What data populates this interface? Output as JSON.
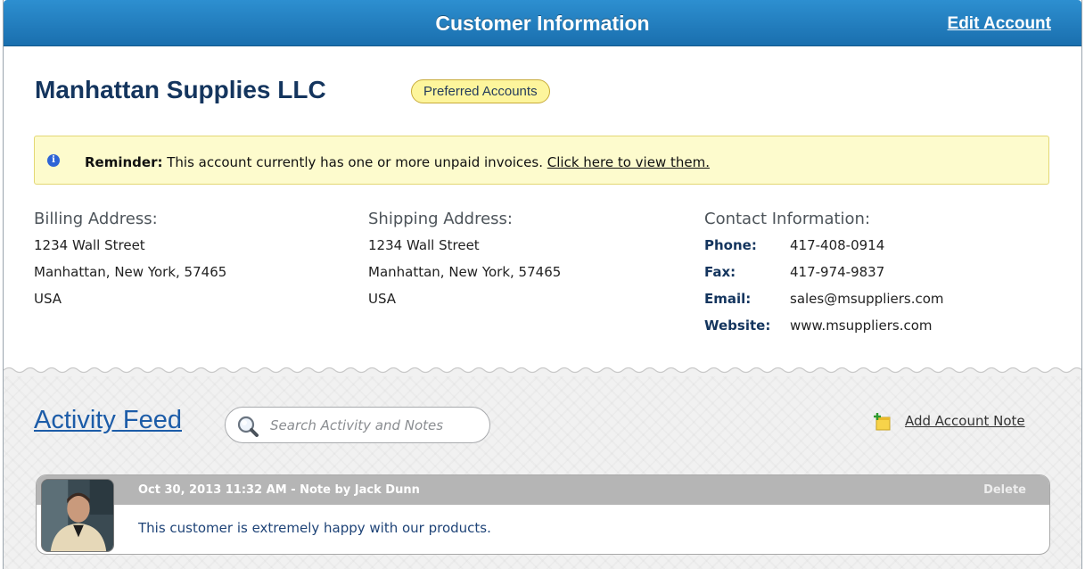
{
  "header": {
    "title": "Customer Information",
    "edit_label": "Edit Account"
  },
  "company": {
    "name": "Manhattan Supplies LLC",
    "badge": "Preferred Accounts"
  },
  "reminder": {
    "label": "Reminder:",
    "text": "This account currently has one or more unpaid invoices.",
    "link": "Click here to view them."
  },
  "billing": {
    "heading": "Billing Address:",
    "street": "1234 Wall Street",
    "city": "Manhattan, New York, 57465",
    "country": "USA"
  },
  "shipping": {
    "heading": "Shipping Address:",
    "street": "1234 Wall Street",
    "city": "Manhattan, New York, 57465",
    "country": "USA"
  },
  "contact": {
    "heading": "Contact Information:",
    "rows": [
      {
        "key": "Phone:",
        "value": "417-408-0914"
      },
      {
        "key": "Fax:",
        "value": "417-974-9837"
      },
      {
        "key": "Email:",
        "value": "sales@msuppliers.com"
      },
      {
        "key": "Website:",
        "value": "www.msuppliers.com"
      }
    ]
  },
  "activity": {
    "title": "Activity Feed",
    "search_placeholder": "Search Activity and Notes",
    "add_note_label": "Add Account Note"
  },
  "notes": [
    {
      "meta": "Oct 30, 2013 11:32 AM - Note by Jack Dunn",
      "delete_label": "Delete",
      "body": "This customer is extremely happy with our products."
    }
  ],
  "colors": {
    "header_blue": "#1f7cc0",
    "title_navy": "#14355e",
    "badge_yellow": "#fdf59c",
    "reminder_bg": "#fdfbcd",
    "link_blue": "#1c5ca8"
  }
}
